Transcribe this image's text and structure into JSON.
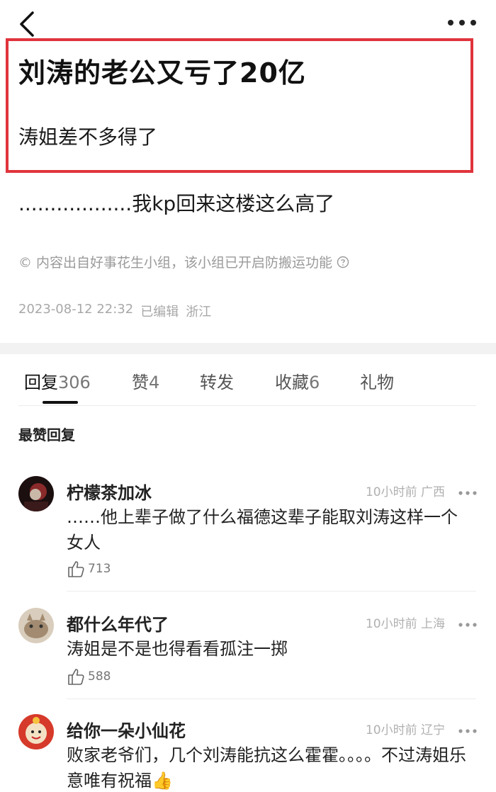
{
  "header": {
    "back_icon": "chevron-left-icon",
    "more_icon": "more-dots-icon"
  },
  "post": {
    "title": "刘涛的老公又亏了20亿",
    "subtitle": "涛姐差不多得了",
    "line": "..................我kp回来这楼这么高了",
    "copyright": "© 内容出自好事花生小组，该小组已开启防搬运功能",
    "copyright_help_icon": "question-circle-icon",
    "date": "2023-08-12 22:32",
    "edited": "已编辑",
    "location": "浙江",
    "highlight_color": "#e0343c"
  },
  "tabs": [
    {
      "label": "回复",
      "count": "306"
    },
    {
      "label": "赞",
      "count": "4"
    },
    {
      "label": "转发",
      "count": ""
    },
    {
      "label": "收藏",
      "count": "6"
    },
    {
      "label": "礼物",
      "count": ""
    }
  ],
  "section_title": "最赞回复",
  "comments": [
    {
      "name": "柠檬茶加冰",
      "time": "10小时前",
      "region": "广西",
      "text": "……他上辈子做了什么福德这辈子能取刘涛这样一个女人",
      "likes": "713"
    },
    {
      "name": "都什么年代了",
      "time": "10小时前",
      "region": "上海",
      "text": "涛姐是不是也得看看孤注一掷",
      "likes": "588"
    },
    {
      "name": "给你一朵小仙花",
      "time": "10小时前",
      "region": "辽宁",
      "text": "败家老爷们，几个刘涛能抗这么霍霍。。。。不过涛姐乐意唯有祝福👍"
    }
  ]
}
